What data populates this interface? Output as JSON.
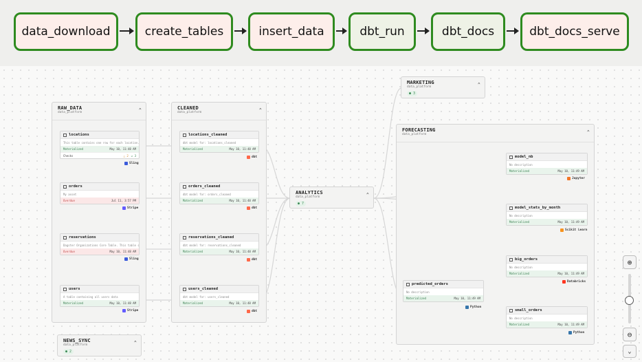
{
  "pipeline": {
    "tasks": [
      {
        "label": "data_download",
        "status": "failed"
      },
      {
        "label": "create_tables",
        "status": "failed"
      },
      {
        "label": "insert_data",
        "status": "failed"
      },
      {
        "label": "dbt_run",
        "status": "success"
      },
      {
        "label": "dbt_docs",
        "status": "success"
      },
      {
        "label": "dbt_docs_serve",
        "status": "failed"
      }
    ]
  },
  "colors": {
    "success_border": "#2e8b1f",
    "failed_bg": "#fdeeea",
    "success_bg": "#eef2e6"
  },
  "groups": {
    "raw_data": {
      "name": "RAW_DATA",
      "location": "data_platform"
    },
    "cleaned": {
      "name": "CLEANED",
      "location": "data_platform"
    },
    "analytics": {
      "name": "ANALYTICS",
      "location": "data_platform",
      "count": "7"
    },
    "marketing": {
      "name": "MARKETING",
      "location": "data_platform",
      "count": "3"
    },
    "forecasting": {
      "name": "FORECASTING",
      "location": "data_platform"
    },
    "news_sync": {
      "name": "NEWS_SYNC",
      "location": "data_platform",
      "count": "2"
    }
  },
  "assets": {
    "locations": {
      "name": "locations",
      "desc": "This table contains one row for each location.",
      "status": "Materialized",
      "time": "May 10, 11:48 AM",
      "checks_label": "Checks",
      "checks_warn": "2",
      "checks_ok": "3",
      "tool": "Sling"
    },
    "orders": {
      "name": "orders",
      "desc": "My asset",
      "status": "Overdue",
      "time": "Jul 11, 3:57 PM",
      "tool": "Stripe"
    },
    "reservations": {
      "name": "reservations",
      "desc": "Dagster Organizations Core Table. This table con...",
      "status": "Overdue",
      "time": "May 10, 11:48 AM",
      "tool": "Sling"
    },
    "users": {
      "name": "users",
      "desc": "A table containing all users data",
      "status": "Materialized",
      "time": "May 10, 11:48 AM",
      "tool": "Stripe"
    },
    "locations_cleaned": {
      "name": "locations_cleaned",
      "desc": "dbt model for: locations_cleaned",
      "status": "Materialized",
      "time": "May 10, 11:48 AM",
      "tool": "dbt"
    },
    "orders_cleaned": {
      "name": "orders_cleaned",
      "desc": "dbt model for: orders_cleaned",
      "status": "Materialized",
      "time": "May 10, 11:48 AM",
      "tool": "dbt"
    },
    "reservations_cleaned": {
      "name": "reservations_cleaned",
      "desc": "dbt model for: reservations_cleaned",
      "status": "Materialized",
      "time": "May 10, 11:48 AM",
      "tool": "dbt"
    },
    "users_cleaned": {
      "name": "users_cleaned",
      "desc": "dbt model for: users_cleaned",
      "status": "Materialized",
      "time": "May 10, 11:48 AM",
      "tool": "dbt"
    },
    "model_nb": {
      "name": "model_nb",
      "desc": "No description",
      "status": "Materialized",
      "time": "May 10, 11:49 AM",
      "tool": "Jupyter"
    },
    "model_stats_by_month": {
      "name": "model_stats_by_month",
      "desc": "No description",
      "status": "Materialized",
      "time": "May 10, 11:49 AM",
      "tool": "Scikit Learn"
    },
    "big_orders": {
      "name": "big_orders",
      "desc": "No description",
      "status": "Materialized",
      "time": "May 10, 11:49 AM",
      "tool": "Databricks"
    },
    "small_orders": {
      "name": "small_orders",
      "desc": "No description",
      "status": "Materialized",
      "time": "May 10, 11:49 AM",
      "tool": "Python"
    },
    "predicted_orders": {
      "name": "predicted_orders",
      "desc": "No description",
      "status": "Materialized",
      "time": "May 10, 11:49 AM",
      "tool": "Python"
    }
  },
  "tool_colors": {
    "Sling": "#3b5bdb",
    "Stripe": "#635bff",
    "dbt": "#ff694a",
    "Jupyter": "#f37726",
    "Scikit Learn": "#f7931e",
    "Databricks": "#ff3621",
    "Python": "#3776ab"
  },
  "icons": {
    "zoom_in": "zoom-in-icon",
    "zoom_out": "zoom-out-icon",
    "collapse": "chevron-updown-icon",
    "fit": "collapse-all-icon"
  }
}
